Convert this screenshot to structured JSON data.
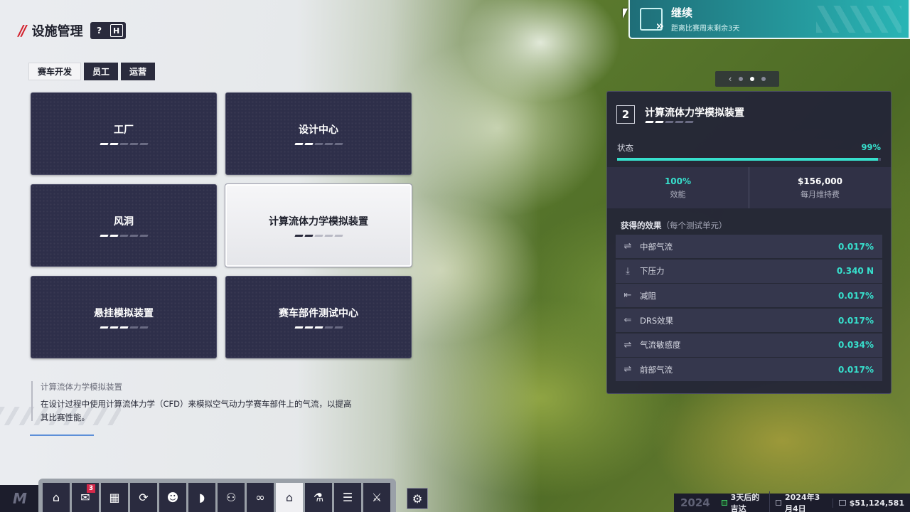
{
  "header": {
    "title": "设施管理",
    "help_key": "?",
    "hotkey": "H"
  },
  "tabs": [
    {
      "label": "赛车开发",
      "active": true
    },
    {
      "label": "员工",
      "active": false
    },
    {
      "label": "运营",
      "active": false
    }
  ],
  "facilities": [
    {
      "name": "工厂",
      "level": 2,
      "max_level": 5
    },
    {
      "name": "设计中心",
      "level": 2,
      "max_level": 5
    },
    {
      "name": "风洞",
      "level": 2,
      "max_level": 5
    },
    {
      "name": "计算流体力学模拟装置",
      "level": 2,
      "max_level": 5,
      "selected": true
    },
    {
      "name": "悬挂模拟装置",
      "level": 3,
      "max_level": 5
    },
    {
      "name": "赛车部件测试中心",
      "level": 3,
      "max_level": 5
    }
  ],
  "description": {
    "title": "计算流体力学模拟装置",
    "text_line1": "在设计过程中使用计算流体力学（CFD）来模拟空气动力学赛车部件上的气流，以提高",
    "text_line2": "其比赛性能。"
  },
  "continue": {
    "label": "继续",
    "sub": "距离比赛周末剩余3天"
  },
  "pager": {
    "prev": "‹",
    "pages": 3,
    "current": 1
  },
  "panel": {
    "number": "2",
    "title": "计算流体力学模拟装置",
    "level": 2,
    "max_level": 5,
    "status_label": "状态",
    "status_value": "99%",
    "status_fraction": 0.99,
    "efficiency_value": "100%",
    "efficiency_label": "效能",
    "upkeep_value": "$156,000",
    "upkeep_label": "每月维持费",
    "effects_title": "获得的效果",
    "effects_sub": "（每个测试单元）",
    "effects": [
      {
        "icon": "mid-airflow-icon",
        "glyph": "⇌",
        "name": "中部气流",
        "value": "0.017%"
      },
      {
        "icon": "downforce-icon",
        "glyph": "⤓",
        "name": "下压力",
        "value": "0.340 N"
      },
      {
        "icon": "drag-reduction-icon",
        "glyph": "⇤",
        "name": "减阻",
        "value": "0.017%"
      },
      {
        "icon": "drs-icon",
        "glyph": "⇐",
        "name": "DRS效果",
        "value": "0.017%"
      },
      {
        "icon": "airflow-sensitivity-icon",
        "glyph": "⇌",
        "name": "气流敏感度",
        "value": "0.034%"
      },
      {
        "icon": "front-airflow-icon",
        "glyph": "⇌",
        "name": "前部气流",
        "value": "0.017%"
      }
    ]
  },
  "dock": [
    {
      "icon": "home-icon",
      "glyph": "⌂"
    },
    {
      "icon": "mail-icon",
      "glyph": "✉",
      "badge": "3"
    },
    {
      "icon": "calendar-icon",
      "glyph": "▦"
    },
    {
      "icon": "track-icon",
      "glyph": "⟳"
    },
    {
      "icon": "driver-icon",
      "glyph": "☻"
    },
    {
      "icon": "helmet-icon",
      "glyph": "◗"
    },
    {
      "icon": "staff-icon",
      "glyph": "⚇"
    },
    {
      "icon": "scouting-icon",
      "glyph": "∞"
    },
    {
      "icon": "facilities-icon",
      "glyph": "⌂",
      "active": true
    },
    {
      "icon": "research-icon",
      "glyph": "⚗"
    },
    {
      "icon": "finance-icon",
      "glyph": "☰"
    },
    {
      "icon": "sponsor-icon",
      "glyph": "⚔"
    }
  ],
  "settings_icon": "⚙",
  "logo": "M",
  "statusbar": {
    "year": "2024",
    "next_event": "3天后的吉达",
    "date": "2024年3月4日",
    "money": "$51,124,581"
  },
  "colors": {
    "accent": "#37e0cd",
    "card_bg": "#2e2f4a",
    "continue_bg": "#29b5b5",
    "brand_red": "#d3222e"
  }
}
